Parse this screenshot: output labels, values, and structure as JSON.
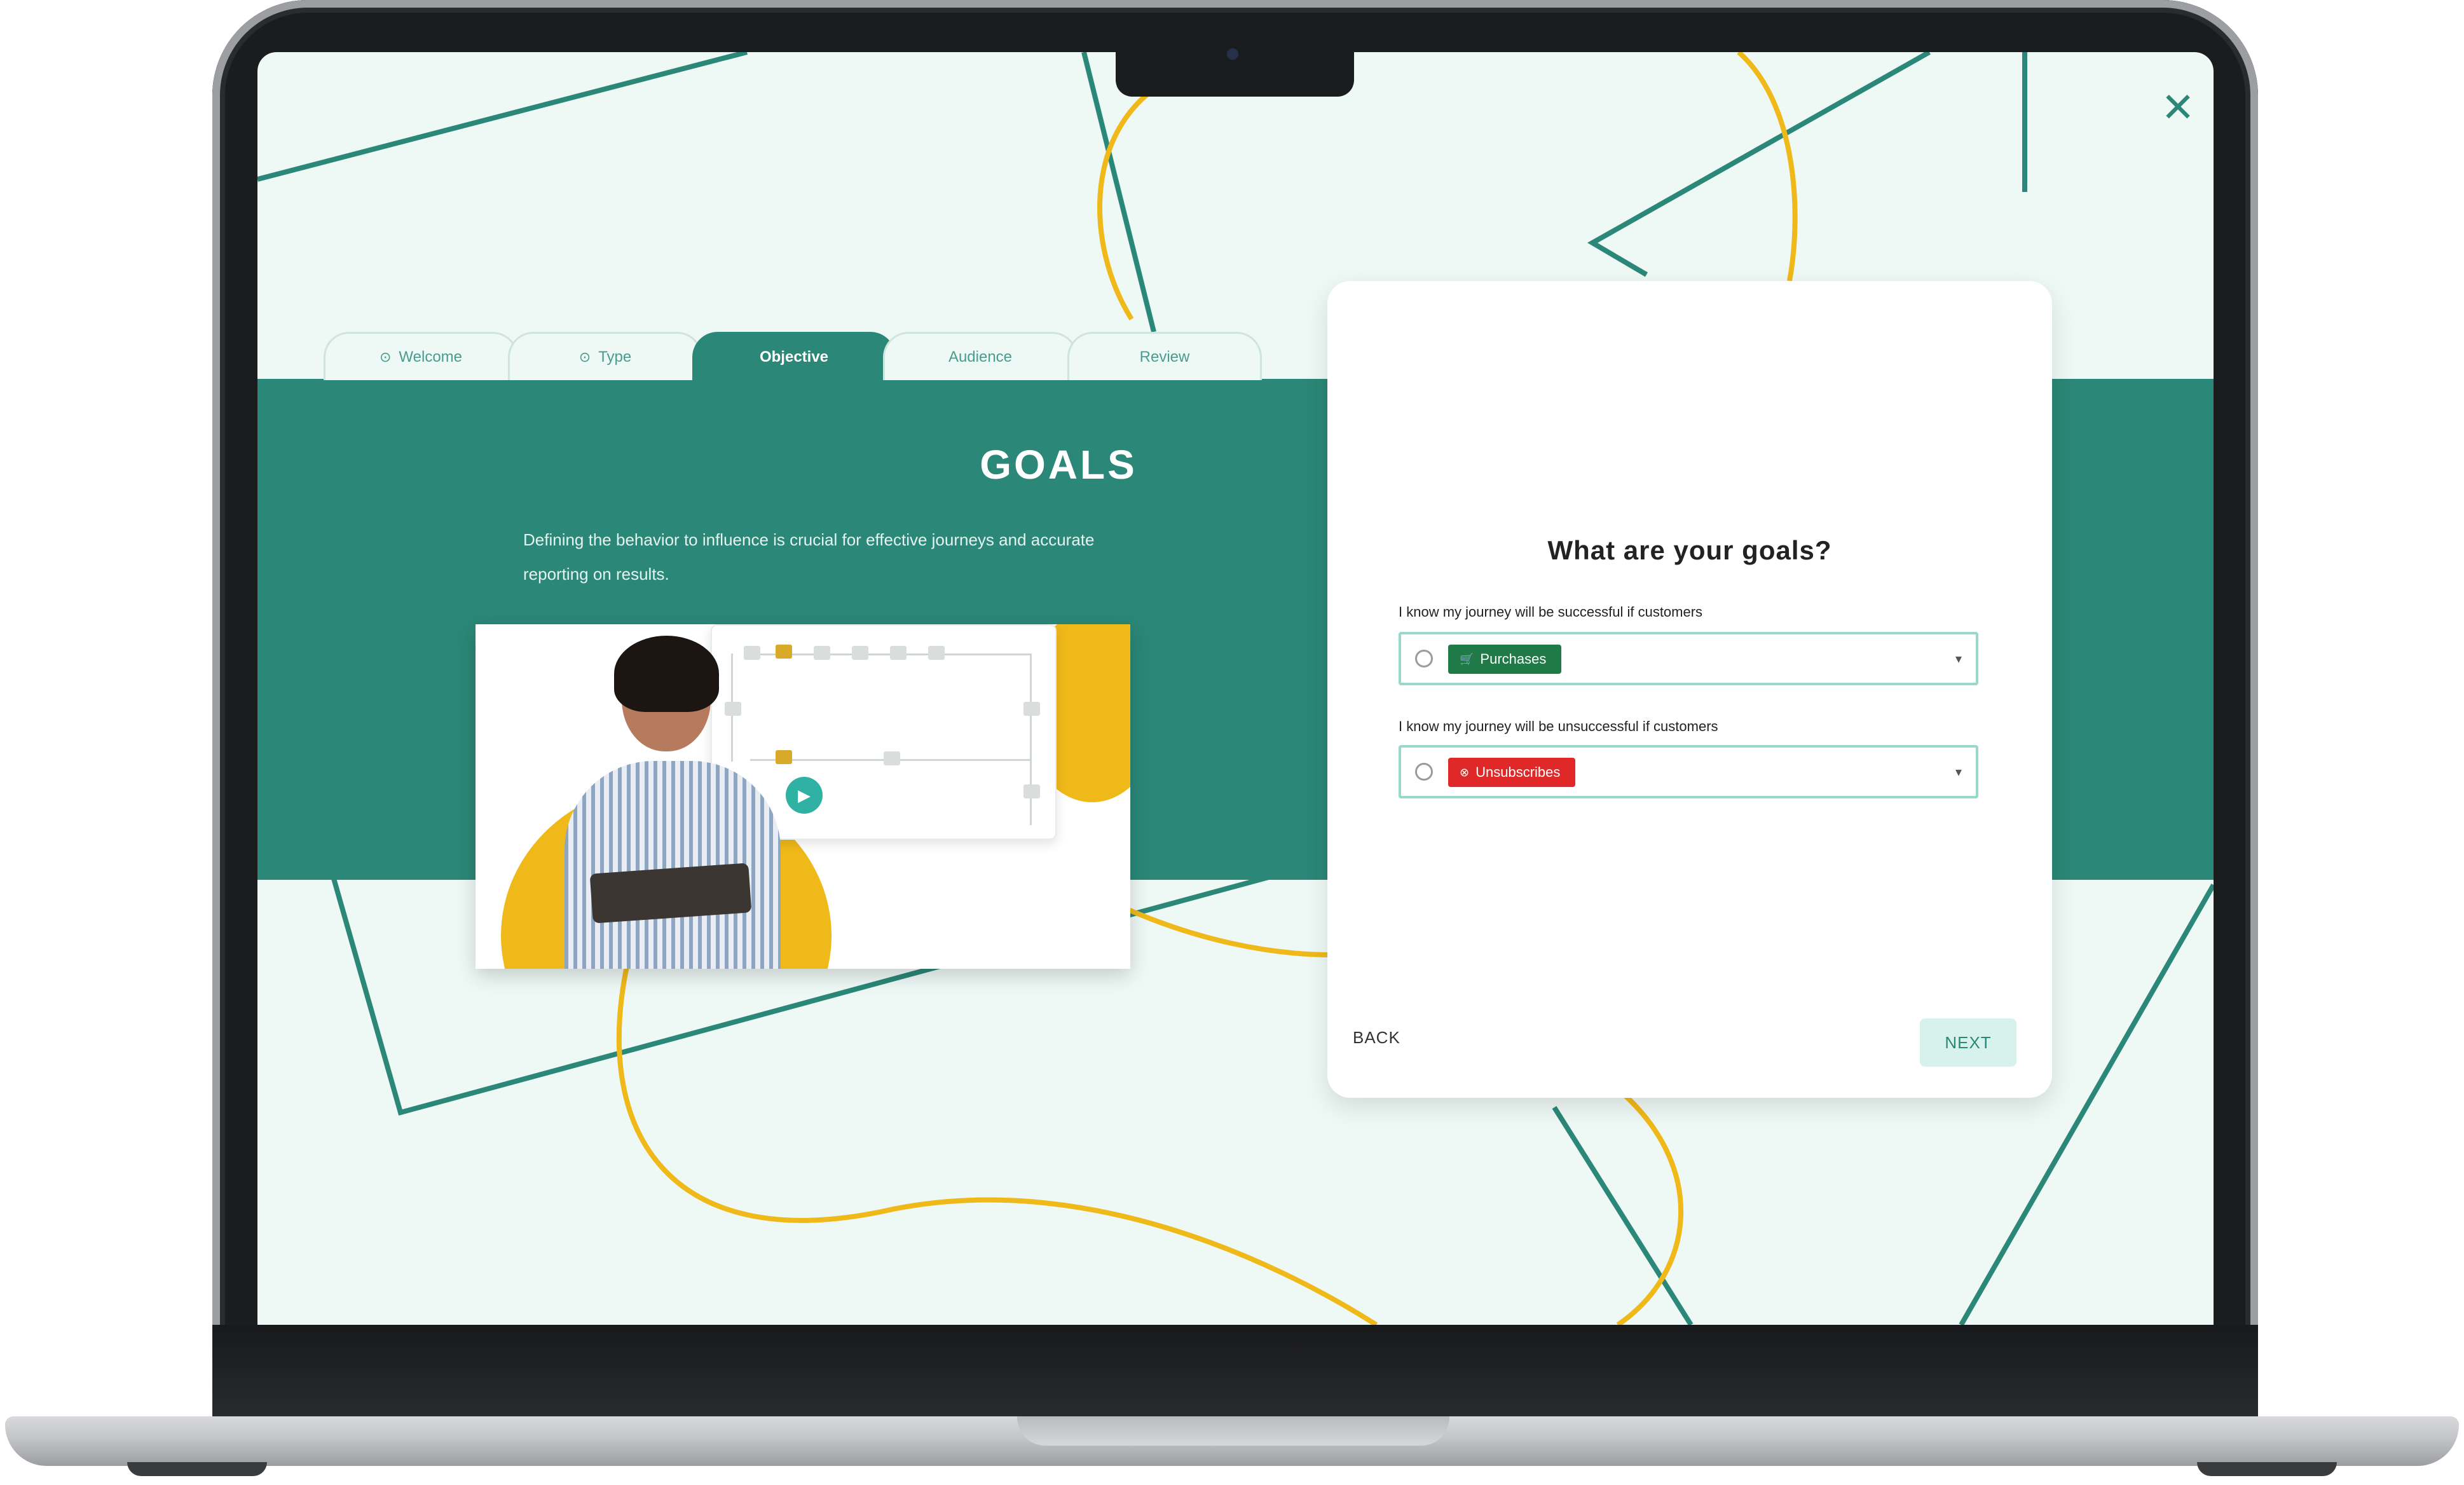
{
  "wizard": {
    "tabs": [
      {
        "label": "Welcome",
        "completed": true,
        "active": false
      },
      {
        "label": "Type",
        "completed": true,
        "active": false
      },
      {
        "label": "Objective",
        "completed": false,
        "active": true
      },
      {
        "label": "Audience",
        "completed": false,
        "active": false
      },
      {
        "label": "Review",
        "completed": false,
        "active": false
      }
    ],
    "check_glyph": "⊙"
  },
  "intro": {
    "title": "GOALS",
    "description": "Defining the behavior to influence is crucial for effective journeys and accurate reporting on results."
  },
  "goals_card": {
    "title": "What are your goals?",
    "success": {
      "label": "I know my journey will be successful if customers",
      "selected": "Purchases",
      "icon": "cart-icon",
      "color": "#1f7a47"
    },
    "failure": {
      "label": "I know my journey will be unsuccessful if customers",
      "selected": "Unsubscribes",
      "icon": "unsubscribe-icon",
      "color": "#e12828"
    },
    "back_label": "BACK",
    "next_label": "NEXT"
  },
  "colors": {
    "brand_teal": "#2b8777",
    "accent_yellow": "#f0b91a",
    "background_mint": "#eef8f5"
  },
  "icons": {
    "close": "close-icon",
    "play": "play-icon",
    "dropdown": "chevron-down-icon"
  }
}
